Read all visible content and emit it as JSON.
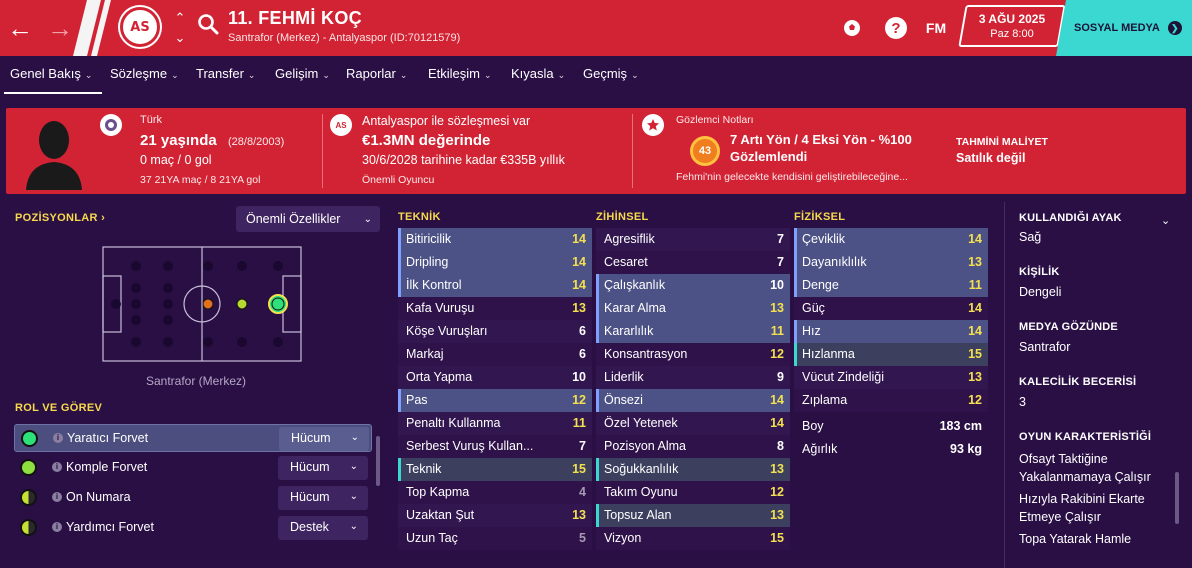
{
  "header": {
    "player_name": "11. FEHMİ KOÇ",
    "player_sub": "Santrafor (Merkez) - Antalyaspor (ID:70121579)",
    "crest_text": "AS",
    "fm_label": "FM",
    "date": "3 AĞU 2025",
    "day_time": "Paz 8:00",
    "social_label": "SOSYAL MEDYA"
  },
  "tabs": [
    {
      "label": "Genel Bakış"
    },
    {
      "label": "Sözleşme"
    },
    {
      "label": "Transfer"
    },
    {
      "label": "Gelişim"
    },
    {
      "label": "Raporlar"
    },
    {
      "label": "Etkileşim"
    },
    {
      "label": "Kıyasla"
    },
    {
      "label": "Geçmiş"
    }
  ],
  "info": {
    "nationality": "Türk",
    "age": "21 yaşında",
    "dob": "(28/8/2003)",
    "apps": "0 maç / 0 gol",
    "youth_apps": "37 21YA maç / 8 21YA gol",
    "contract_club": "Antalyaspor ile sözleşmesi var",
    "value": "€1.3MN değerinde",
    "contract_until": "30/6/2028 tarihine kadar €335B yıllık",
    "squad_status": "Önemli Oyuncu",
    "scout_title": "Gözlemci Notları",
    "scout_rating": "43",
    "scout_summary_1": "7 Artı Yön / 4 Eksi Yön - %100",
    "scout_summary_2": "Gözlemlendi",
    "scout_note": "Fehmi'nin gelecekte kendisini geliştirebileceğine...",
    "cost_label": "TAHMİNİ MALİYET",
    "cost_value": "Satılık değil"
  },
  "positions": {
    "title": "POZİSYONLAR",
    "dropdown": "Önemli Özellikler",
    "caption": "Santrafor (Merkez)"
  },
  "roles": {
    "title": "ROL VE GÖREV",
    "items": [
      {
        "name": "Yaratıcı Forvet",
        "duty": "Hücum"
      },
      {
        "name": "Komple Forvet",
        "duty": "Hücum"
      },
      {
        "name": "On Numara",
        "duty": "Hücum"
      },
      {
        "name": "Yardımcı Forvet",
        "duty": "Destek"
      }
    ]
  },
  "technical": {
    "title": "TEKNİK",
    "rows": [
      {
        "name": "Bitiricilik",
        "value": "14"
      },
      {
        "name": "Dripling",
        "value": "14"
      },
      {
        "name": "İlk Kontrol",
        "value": "14"
      },
      {
        "name": "Kafa Vuruşu",
        "value": "13"
      },
      {
        "name": "Köşe Vuruşları",
        "value": "6"
      },
      {
        "name": "Markaj",
        "value": "6"
      },
      {
        "name": "Orta Yapma",
        "value": "10"
      },
      {
        "name": "Pas",
        "value": "12"
      },
      {
        "name": "Penaltı Kullanma",
        "value": "11"
      },
      {
        "name": "Serbest Vuruş Kullan...",
        "value": "7"
      },
      {
        "name": "Teknik",
        "value": "15"
      },
      {
        "name": "Top Kapma",
        "value": "4"
      },
      {
        "name": "Uzaktan Şut",
        "value": "13"
      },
      {
        "name": "Uzun Taç",
        "value": "5"
      }
    ]
  },
  "mental": {
    "title": "ZİHİNSEL",
    "rows": [
      {
        "name": "Agresiflik",
        "value": "7"
      },
      {
        "name": "Cesaret",
        "value": "7"
      },
      {
        "name": "Çalışkanlık",
        "value": "10"
      },
      {
        "name": "Karar Alma",
        "value": "13"
      },
      {
        "name": "Kararlılık",
        "value": "11"
      },
      {
        "name": "Konsantrasyon",
        "value": "12"
      },
      {
        "name": "Liderlik",
        "value": "9"
      },
      {
        "name": "Önsezi",
        "value": "14"
      },
      {
        "name": "Özel Yetenek",
        "value": "14"
      },
      {
        "name": "Pozisyon Alma",
        "value": "8"
      },
      {
        "name": "Soğukkanlılık",
        "value": "13"
      },
      {
        "name": "Takım Oyunu",
        "value": "12"
      },
      {
        "name": "Topsuz Alan",
        "value": "13"
      },
      {
        "name": "Vizyon",
        "value": "15"
      }
    ]
  },
  "physical": {
    "title": "FİZİKSEL",
    "rows": [
      {
        "name": "Çeviklik",
        "value": "14"
      },
      {
        "name": "Dayanıklılık",
        "value": "13"
      },
      {
        "name": "Denge",
        "value": "11"
      },
      {
        "name": "Güç",
        "value": "14"
      },
      {
        "name": "Hız",
        "value": "14"
      },
      {
        "name": "Hızlanma",
        "value": "15"
      },
      {
        "name": "Vücut Zindeliği",
        "value": "13"
      },
      {
        "name": "Zıplama",
        "value": "12"
      }
    ],
    "height_label": "Boy",
    "height_value": "183 cm",
    "weight_label": "Ağırlık",
    "weight_value": "93 kg"
  },
  "details": {
    "foot_label": "KULLANDIĞI AYAK",
    "foot_value": "Sağ",
    "personality_label": "KİŞİLİK",
    "personality_value": "Dengeli",
    "media_label": "MEDYA GÖZÜNDE",
    "media_value": "Santrafor",
    "gk_label": "KALECİLİK BECERİSİ",
    "gk_value": "3",
    "traits_label": "OYUN KARAKTERİSTİĞİ",
    "traits": [
      "Ofsayt Taktiğine Yakalanmamaya Çalışır",
      "Hızıyla Rakibini Ekarte Etmeye Çalışır",
      "Topa Yatarak Hamle"
    ]
  },
  "colors": {
    "header_red": "#d22334",
    "background": "#2a0f45",
    "accent_teal": "#3ad8d0",
    "section_yellow": "#f7d94c"
  }
}
